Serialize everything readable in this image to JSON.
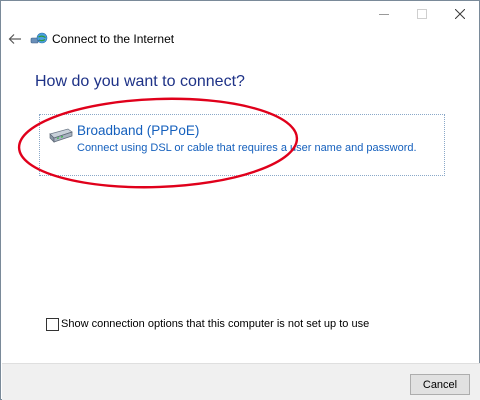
{
  "window": {
    "title": "Connect to the Internet",
    "caption_buttons": [
      "minimize-icon",
      "maximize-icon",
      "close-icon"
    ]
  },
  "main": {
    "heading": "How do you want to connect?",
    "options": [
      {
        "icon": "broadband-modem-icon",
        "title": "Broadband (PPPoE)",
        "description": "Connect using DSL or cable that requires a user name and password."
      }
    ],
    "show_options_checkbox": {
      "label": "Show connection options that this computer is not set up to use",
      "checked": false
    }
  },
  "footer": {
    "cancel_label": "Cancel"
  },
  "colors": {
    "heading": "#1e3287",
    "link": "#1560bd",
    "annotation": "#e0001b",
    "footer_bg": "#f0f0f0"
  }
}
